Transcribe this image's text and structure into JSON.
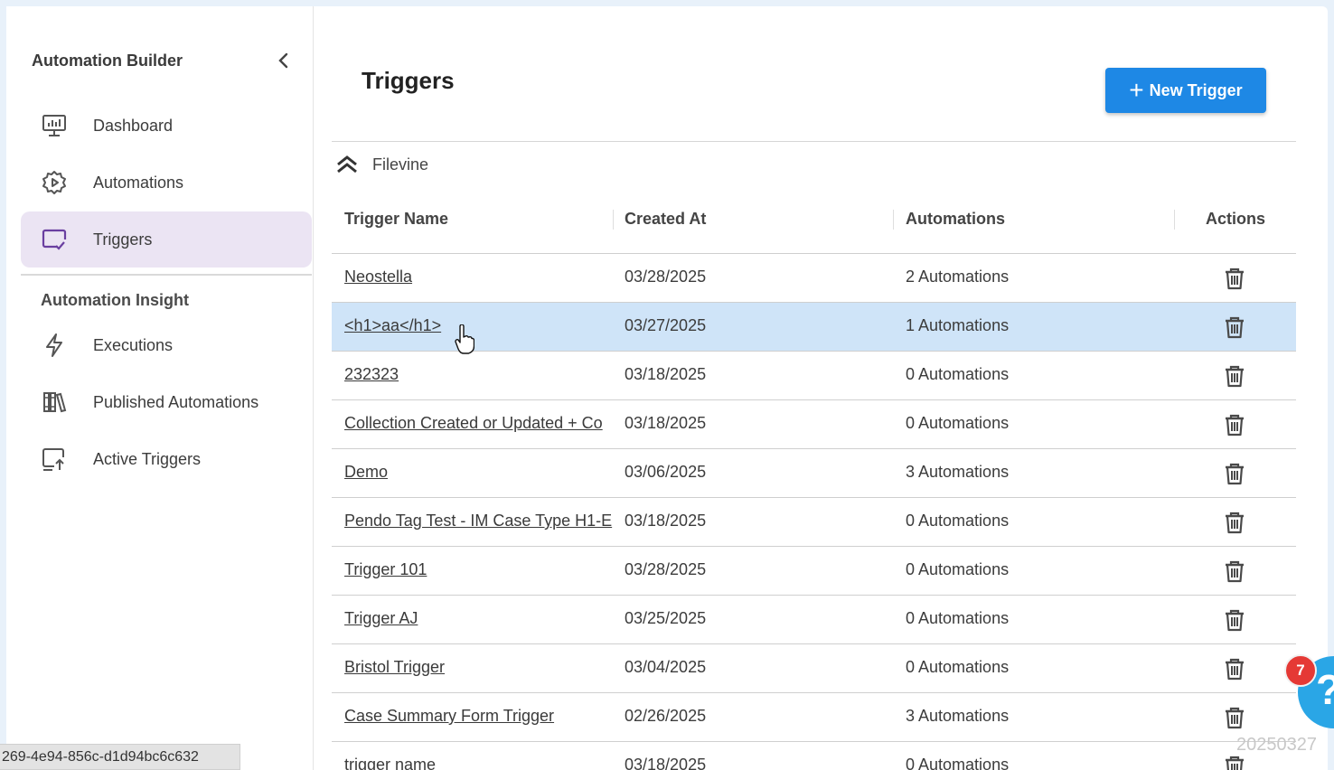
{
  "sidebar": {
    "title": "Automation Builder",
    "items": [
      {
        "label": "Dashboard",
        "icon": "monitor-chart-icon"
      },
      {
        "label": "Automations",
        "icon": "gear-play-icon"
      },
      {
        "label": "Triggers",
        "icon": "screen-check-icon",
        "active": true
      }
    ],
    "section_title": "Automation Insight",
    "insight_items": [
      {
        "label": "Executions",
        "icon": "lightning-icon"
      },
      {
        "label": "Published Automations",
        "icon": "library-books-icon"
      },
      {
        "label": "Active Triggers",
        "icon": "screen-upload-icon"
      }
    ]
  },
  "header": {
    "title": "Triggers",
    "new_button_plus": "+",
    "new_button_label": "New Trigger"
  },
  "group": {
    "name": "Filevine",
    "icon": "chevron-double-up-icon"
  },
  "table": {
    "columns": [
      "Trigger Name",
      "Created At",
      "Automations",
      "Actions"
    ],
    "rows": [
      {
        "name": "Neostella",
        "created": "03/28/2025",
        "automations": "2 Automations"
      },
      {
        "name": "<h1>aa</h1>",
        "created": "03/27/2025",
        "automations": "1 Automations"
      },
      {
        "name": "232323",
        "created": "03/18/2025",
        "automations": "0 Automations"
      },
      {
        "name": "Collection Created or Updated + Co",
        "created": "03/18/2025",
        "automations": "0 Automations"
      },
      {
        "name": "Demo",
        "created": "03/06/2025",
        "automations": "3 Automations"
      },
      {
        "name": "Pendo Tag Test - IM Case Type H1-E",
        "created": "03/18/2025",
        "automations": "0 Automations"
      },
      {
        "name": "Trigger 101",
        "created": "03/28/2025",
        "automations": "0 Automations"
      },
      {
        "name": "Trigger AJ",
        "created": "03/25/2025",
        "automations": "0 Automations"
      },
      {
        "name": "Bristol Trigger",
        "created": "03/04/2025",
        "automations": "0 Automations"
      },
      {
        "name": "Case Summary Form Trigger",
        "created": "02/26/2025",
        "automations": "3 Automations"
      },
      {
        "name": "trigger name",
        "created": "03/18/2025",
        "automations": "0 Automations"
      }
    ],
    "highlighted_row": 1
  },
  "status_bar_url": "269-4e94-856c-d1d94bc6c632",
  "help": {
    "badge_count": "7",
    "symbol": "?"
  },
  "watermark": "20250327",
  "colors": {
    "accent": "#1e88e5",
    "active_bg": "#ebe4f3",
    "highlight_row": "#cfe4f8",
    "badge": "#e53935"
  }
}
